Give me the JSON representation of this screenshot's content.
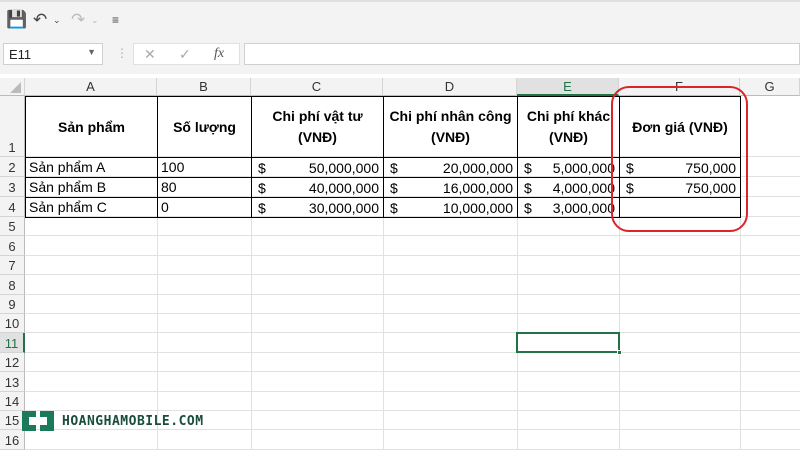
{
  "qat": {
    "save": "save-icon",
    "undo": "undo-icon",
    "redo": "redo-icon",
    "customize": "customize-icon"
  },
  "formula_bar": {
    "name_box": "E11",
    "fx": "fx",
    "value": ""
  },
  "columns": [
    "A",
    "B",
    "C",
    "D",
    "E",
    "F",
    "G"
  ],
  "rows": [
    "1",
    "2",
    "3",
    "4",
    "5",
    "6",
    "7",
    "8",
    "9",
    "10",
    "11",
    "12",
    "13",
    "14",
    "15",
    "16"
  ],
  "selected_cell": "E11",
  "headers": [
    "Sản phẩm",
    "Số lượng",
    "Chi phí vật tư (VNĐ)",
    "Chi phí nhân công (VNĐ)",
    "Chi phí khác (VNĐ)",
    "Đơn giá (VNĐ)"
  ],
  "data": [
    {
      "name": "Sản phẩm A",
      "qty": "100",
      "material": "50,000,000",
      "labor": "20,000,000",
      "other": "5,000,000",
      "price": "750,000"
    },
    {
      "name": "Sản phẩm B",
      "qty": "80",
      "material": "40,000,000",
      "labor": "16,000,000",
      "other": "4,000,000",
      "price": "750,000"
    },
    {
      "name": "Sản phẩm C",
      "qty": "0",
      "material": "30,000,000",
      "labor": "10,000,000",
      "other": "3,000,000",
      "price": ""
    }
  ],
  "currency": "$",
  "highlight_color": "#d9252b",
  "watermark": "HOANGHAMOBILE.COM"
}
